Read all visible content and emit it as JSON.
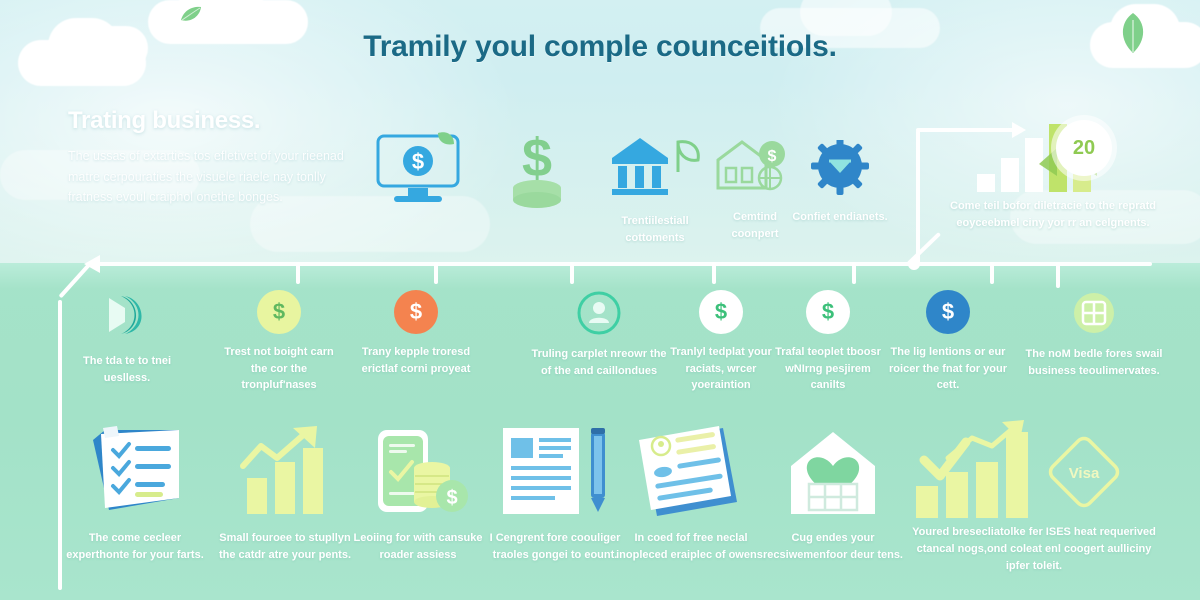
{
  "headline": "Tramily youl comple counceitiols.",
  "intro": {
    "title": "Trating business.",
    "body": "The ussas of extarties tos efletivet of your rieenad matre cerpouraties the visuele riaele nay tonlly fratness evoul craiphol onethe bonges."
  },
  "top_row": [
    {
      "icon": "monitor-dollar-icon",
      "label": ""
    },
    {
      "icon": "money-plant-icon",
      "label": ""
    },
    {
      "icon": "bank-building-icon",
      "label": "Trentiilestiall cottoments"
    },
    {
      "icon": "house-savings-icon",
      "label": "Cemtind coonpert"
    },
    {
      "icon": "gear-envelope-icon",
      "label": "Confiet endianets."
    },
    {
      "icon": "bar-chart-badge-icon",
      "label": "Come teil bofor diletracie to the repratd eoyceebmel ciny yor rr an celgnents."
    }
  ],
  "top_badge": "20",
  "mid_row": [
    {
      "icon": "crescent-teal-icon",
      "color": "#2fb8a8",
      "label": "The tda te to tnei ueslless."
    },
    {
      "icon": "dollar-coin-icon",
      "color": "#e8f5a0",
      "label": "Trest not boight carn the cor the tronpluf'nases"
    },
    {
      "icon": "dollar-coin-icon",
      "color": "#f4834f",
      "label": "Trany kepple troresd erictlaf corni proyeat"
    },
    {
      "icon": "user-circle-icon",
      "color": "#3fcfa4",
      "label": "Truling carplet nreowr the of the and caillondues"
    },
    {
      "icon": "dollar-coin-icon",
      "color": "#ffffff",
      "label": "Tranlyl tedplat your raciats, wrcer yoeraintion"
    },
    {
      "icon": "dollar-coin-icon",
      "color": "#ffffff",
      "label": "Trafal teoplet tboosr wNIrng pesjirem canilts"
    },
    {
      "icon": "dollar-coin-icon",
      "color": "#2f86c9",
      "label": "The lig lentions or eur roicer the fnat for your cett."
    },
    {
      "icon": "window-grid-icon",
      "color": "#b9e88a",
      "label": "The noM bedle fores swail business teoulimervates."
    }
  ],
  "bottom_row": [
    {
      "illo": "checklist-clipboard-illo",
      "label": "The come cecleer experthonte for your farts."
    },
    {
      "illo": "growth-bar-chart-illo",
      "label": "Small fouroee to stupllyn the catdr atre your pents."
    },
    {
      "illo": "phone-coins-illo",
      "label": "Leoiing for with cansuke roader assiess"
    },
    {
      "illo": "document-pencil-illo",
      "label": "I Cengrent fore coouliger traoles gongei to eount."
    },
    {
      "illo": "id-document-illo",
      "label": "In coed fof free neclal inopleced eraiplec of owens."
    },
    {
      "illo": "house-heart-illo",
      "label": "Cug endes your recsiwemenfoor deur tens."
    },
    {
      "illo": "check-growth-chart-illo",
      "label": "Youred bresecliatolke fer ISES heat requerived ctancal nogs,ond coleat enl coogert aulliciny ipfer toleit."
    }
  ],
  "colors": {
    "sky": "#d2eff1",
    "band": "#a4e2c9",
    "headline": "#1b6a86",
    "blue": "#35a8e0",
    "dark_blue": "#2f86c9",
    "green": "#82cf8e",
    "lime": "#e9f59a",
    "orange": "#f4834f",
    "teal": "#3fcfa4",
    "white": "#ffffff"
  }
}
